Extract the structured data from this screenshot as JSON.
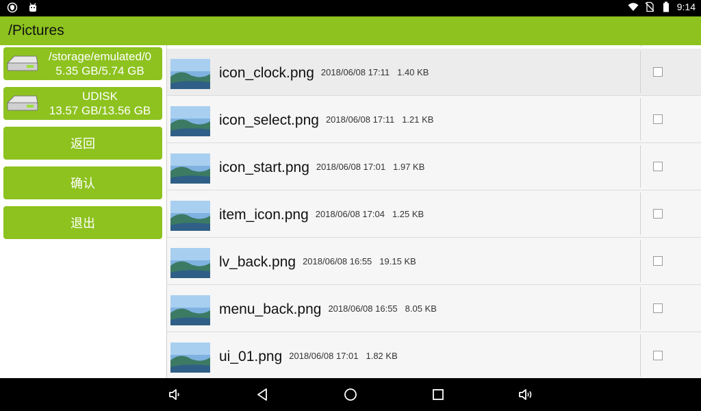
{
  "status_bar": {
    "time": "9:14"
  },
  "title_bar": {
    "path": "/Pictures"
  },
  "sidebar": {
    "storages": [
      {
        "name": "/storage/emulated/0",
        "size": "5.35 GB/5.74 GB"
      },
      {
        "name": "UDISK",
        "size": "13.57 GB/13.56 GB"
      }
    ],
    "buttons": {
      "back": "返回",
      "confirm": "确认",
      "exit": "退出"
    }
  },
  "files": [
    {
      "name": "icon_clock.png",
      "date": "2018/06/08 17:11",
      "size": "1.40 KB",
      "selected": true
    },
    {
      "name": "icon_select.png",
      "date": "2018/06/08 17:11",
      "size": "1.21 KB"
    },
    {
      "name": "icon_start.png",
      "date": "2018/06/08 17:01",
      "size": "1.97 KB"
    },
    {
      "name": "item_icon.png",
      "date": "2018/06/08 17:04",
      "size": "1.25 KB"
    },
    {
      "name": "lv_back.png",
      "date": "2018/06/08 16:55",
      "size": "19.15 KB"
    },
    {
      "name": "menu_back.png",
      "date": "2018/06/08 16:55",
      "size": "8.05 KB"
    },
    {
      "name": "ui_01.png",
      "date": "2018/06/08 17:01",
      "size": "1.82 KB"
    }
  ],
  "colors": {
    "accent": "#8dc21f",
    "status_bar": "#000000",
    "row_bg": "#f6f6f6"
  },
  "icons": {
    "status_left": [
      "shield-icon",
      "android-icon"
    ],
    "status_right": [
      "wifi-icon",
      "no-sim-icon",
      "battery-icon"
    ],
    "nav": [
      "volume-down-icon",
      "back-icon",
      "home-icon",
      "recents-icon",
      "volume-up-icon"
    ]
  }
}
